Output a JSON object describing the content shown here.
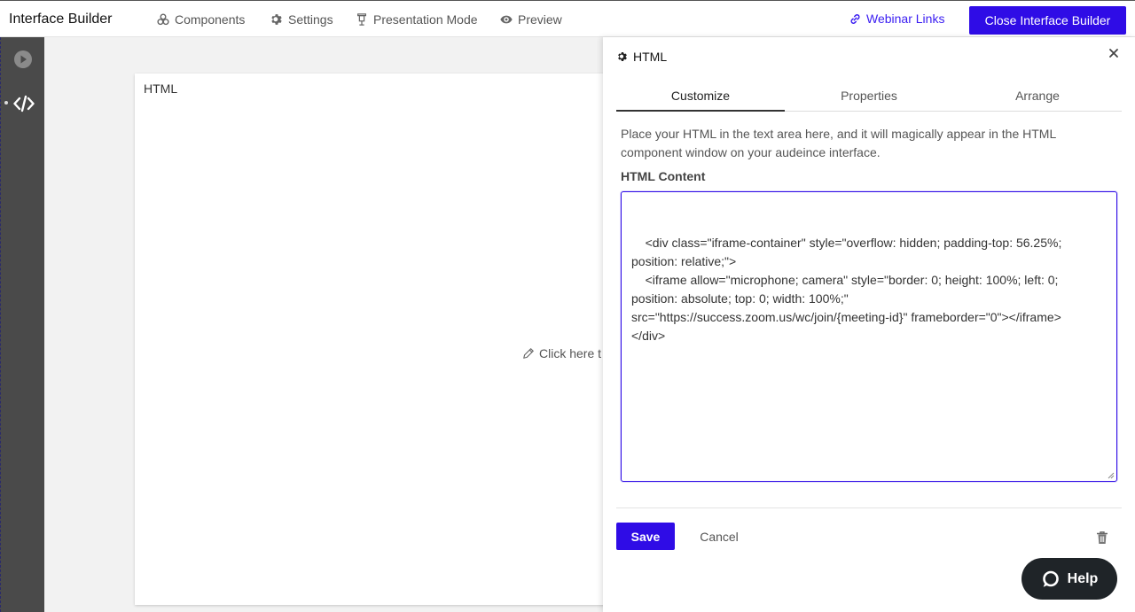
{
  "topbar": {
    "title": "Interface Builder",
    "nav": {
      "components": "Components",
      "settings": "Settings",
      "presentation": "Presentation Mode",
      "preview": "Preview"
    },
    "webinar_links": "Webinar Links",
    "close_builder": "Close Interface Builder"
  },
  "canvas": {
    "card_title": "HTML",
    "card_edit_hint": "Click here t"
  },
  "panel": {
    "title": "HTML",
    "tabs": [
      {
        "label": "Customize",
        "active": true
      },
      {
        "label": "Properties",
        "active": false
      },
      {
        "label": "Arrange",
        "active": false
      }
    ],
    "description": "Place your HTML in the text area here, and it will magically appear in the HTML component window on your audeince interface.",
    "field_label": "HTML Content",
    "html_content": "<div class=\"iframe-container\" style=\"overflow: hidden; padding-top: 56.25%; position: relative;\">\n    <iframe allow=\"microphone; camera\" style=\"border: 0; height: 100%; left: 0; position: absolute; top: 0; width: 100%;\" src=\"https://success.zoom.us/wc/join/{meeting-id}\" frameborder=\"0\"></iframe>\n</div>",
    "save_label": "Save",
    "cancel_label": "Cancel",
    "help_label": "Help"
  },
  "colors": {
    "accent": "#2f0ce6",
    "link": "#3a1df2",
    "sidebar": "#4a4a4a",
    "help_bg": "#1f2428"
  },
  "icons": {
    "components": "components-icon",
    "settings": "gear-icon",
    "presentation": "presentation-icon",
    "preview": "eye-icon",
    "webinar": "link-icon",
    "play": "play-icon",
    "code": "code-icon",
    "edit": "pencil-icon",
    "close": "close-icon",
    "delete": "trash-icon",
    "help": "chat-icon"
  }
}
